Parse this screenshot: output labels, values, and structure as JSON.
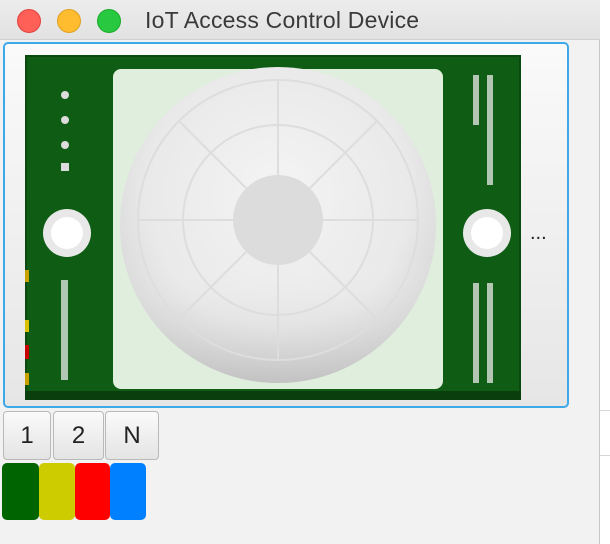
{
  "window": {
    "title": "IoT Access Control Device"
  },
  "preview": {
    "image_description_icon": "pir-motion-sensor-board",
    "more_label": "..."
  },
  "scope_buttons": [
    {
      "label": "1"
    },
    {
      "label": "2"
    },
    {
      "label": "N"
    }
  ],
  "swatches": [
    {
      "name": "green",
      "color": "#006400"
    },
    {
      "name": "yellow",
      "color": "#cccc00"
    },
    {
      "name": "red",
      "color": "#ff0000"
    },
    {
      "name": "blue",
      "color": "#0080ff"
    }
  ],
  "colors": {
    "accent_focus": "#3da9e8",
    "pcb_green": "#0d5c12"
  }
}
